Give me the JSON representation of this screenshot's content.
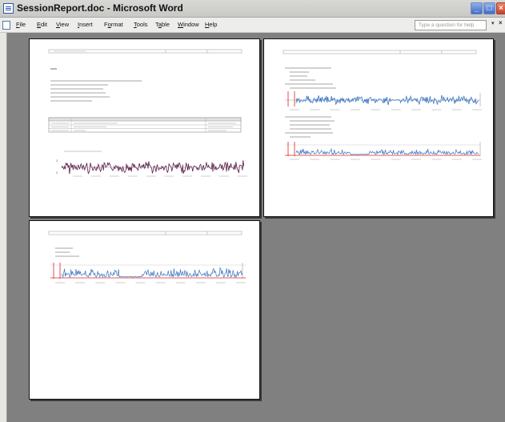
{
  "window": {
    "title": "SessionReport.doc - Microsoft Word",
    "controls": {
      "minimize": "_",
      "maximize": "□",
      "close": "×"
    }
  },
  "menu": {
    "items": [
      {
        "first": "F",
        "rest": "ile"
      },
      {
        "first": "E",
        "rest": "dit"
      },
      {
        "first": "V",
        "rest": "iew"
      },
      {
        "first": "I",
        "rest": "nsert"
      },
      {
        "pre": "F",
        "first": "o",
        "rest": "rmat"
      },
      {
        "first": "T",
        "rest": "ools"
      },
      {
        "pre": "T",
        "first": "a",
        "rest": "ble"
      },
      {
        "first": "W",
        "rest": "indow"
      },
      {
        "first": "H",
        "rest": "elp"
      }
    ],
    "help_placeholder": "Type a question for help",
    "help_arrow": "▾",
    "close_doc": "×"
  },
  "colors": {
    "trace_page1": "#5a1a4a",
    "trace_blue": "#3a74c0",
    "marker_red": "#e02020",
    "gray_text": "#9a9a9a"
  },
  "icons": [
    "word-app-icon",
    "document-icon",
    "minimize-icon",
    "maximize-icon",
    "close-icon"
  ]
}
